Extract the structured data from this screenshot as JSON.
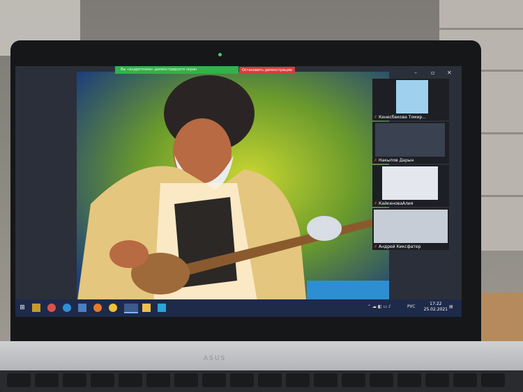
{
  "zoom": {
    "share_bar_text": "Вы «андреткома» демонстрируете экран",
    "stop_share_label": "Остановить демонстрацию",
    "participants": [
      {
        "name": "Кенесбекова Томир..."
      },
      {
        "name": "Накыпов Дарын"
      },
      {
        "name": "КайкеноваАлия"
      },
      {
        "name": "Андрей Киксфатер"
      }
    ]
  },
  "taskbar": {
    "icons": [
      "windows-start-icon",
      "search-icon",
      "task-view-icon",
      "chrome-icon",
      "edge-icon",
      "store-icon",
      "firefox-icon",
      "app-icon",
      "zoom-icon",
      "chat-icon",
      "media-icon"
    ],
    "language": "РУС",
    "time": "17:22",
    "date": "25.02.2021"
  },
  "laptop": {
    "brand": "ASUS"
  },
  "colors": {
    "zoom_green": "#2fb34a",
    "stop_red": "#d93d3d",
    "taskbar": "#1e2a4a"
  }
}
